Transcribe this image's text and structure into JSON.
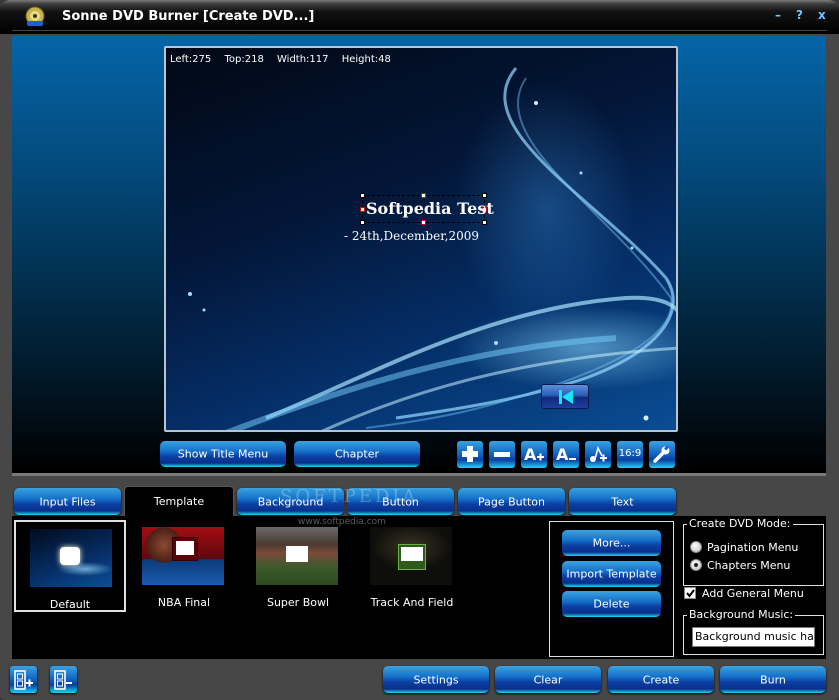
{
  "window": {
    "title": "Sonne DVD Burner [Create DVD...]",
    "controls": {
      "minimize": "–",
      "help": "?",
      "close": "x"
    }
  },
  "preview": {
    "coords": {
      "left": "Left:275",
      "top": "Top:218",
      "width": "Width:117",
      "height": "Height:48"
    },
    "menu_title": "Softpedia Test",
    "menu_subtitle": "- 24th,December,2009",
    "nav_button": "previous-icon"
  },
  "stage_buttons": {
    "show_title_menu": "Show Title Menu",
    "chapter": "Chapter"
  },
  "tool_buttons": [
    {
      "name": "add-icon",
      "label": ""
    },
    {
      "name": "remove-icon",
      "label": ""
    },
    {
      "name": "font-increase-icon",
      "label": ""
    },
    {
      "name": "font-decrease-icon",
      "label": ""
    },
    {
      "name": "add-music-icon",
      "label": ""
    },
    {
      "name": "aspect-ratio",
      "label": "16:9"
    },
    {
      "name": "wrench-icon",
      "label": ""
    }
  ],
  "tabs": [
    {
      "label": "Input Files",
      "active": false
    },
    {
      "label": "Template",
      "active": true
    },
    {
      "label": "Background",
      "active": false
    },
    {
      "label": "Button",
      "active": false
    },
    {
      "label": "Page Button",
      "active": false
    },
    {
      "label": "Text",
      "active": false
    }
  ],
  "templates": [
    {
      "label": "Default",
      "selected": true
    },
    {
      "label": "NBA Final",
      "selected": false
    },
    {
      "label": "Super Bowl",
      "selected": false
    },
    {
      "label": "Track And Field",
      "selected": false
    }
  ],
  "template_actions": {
    "more": "More...",
    "import": "Import Template",
    "delete": "Delete"
  },
  "dvd_mode": {
    "legend": "Create DVD Mode:",
    "options": [
      {
        "label": "Pagination Menu",
        "checked": false
      },
      {
        "label": "Chapters Menu",
        "checked": true
      }
    ]
  },
  "add_general_menu": {
    "label": "Add General Menu",
    "checked": true
  },
  "background_music": {
    "legend": "Background Music:",
    "value": "Background music has not been set"
  },
  "bottom_buttons": {
    "settings": "Settings",
    "clear": "Clear",
    "create": "Create",
    "burn": "Burn"
  },
  "watermark": {
    "text": "SOFTPEDIA",
    "url": "www.softpedia.com"
  },
  "colors": {
    "accent": "#1570c8",
    "accent_glow": "#21d9f5",
    "title_control": "#6fc6ff",
    "panel_bg": "#000000",
    "frame_bg": "#474747"
  }
}
